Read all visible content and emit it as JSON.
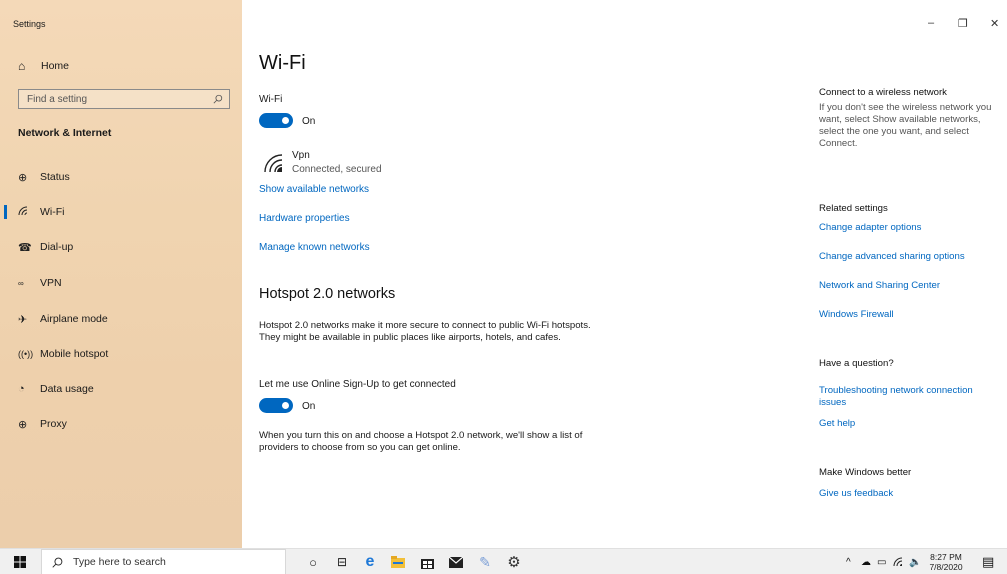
{
  "window": {
    "title": "Settings",
    "minimize": "–",
    "restore": "❐",
    "close": "✕"
  },
  "sidebar": {
    "home_label": "Home",
    "search_placeholder": "Find a setting",
    "section": "Network & Internet",
    "items": [
      {
        "label": "Status",
        "icon": "status-icon"
      },
      {
        "label": "Wi-Fi",
        "icon": "wifi-icon"
      },
      {
        "label": "Dial-up",
        "icon": "dialup-icon"
      },
      {
        "label": "VPN",
        "icon": "vpn-icon"
      },
      {
        "label": "Airplane mode",
        "icon": "airplane-icon"
      },
      {
        "label": "Mobile hotspot",
        "icon": "hotspot-icon"
      },
      {
        "label": "Data usage",
        "icon": "data-usage-icon"
      },
      {
        "label": "Proxy",
        "icon": "proxy-icon"
      }
    ]
  },
  "main": {
    "title": "Wi-Fi",
    "wifi_label": "Wi-Fi",
    "wifi_toggle": "On",
    "network_name": "Vpn",
    "network_status": "Connected, secured",
    "links": [
      "Show available networks",
      "Hardware properties",
      "Manage known networks"
    ],
    "hotspot_title": "Hotspot 2.0 networks",
    "hotspot_desc": "Hotspot 2.0 networks make it more secure to connect to public Wi-Fi hotspots. They might be available in public places like airports, hotels, and cafes.",
    "signup_label": "Let me use Online Sign-Up to get connected",
    "signup_toggle": "On",
    "signup_desc": "When you turn this on and choose a Hotspot 2.0 network, we'll show a list of providers to choose from so you can get online."
  },
  "right": {
    "connect_title": "Connect to a wireless network",
    "connect_desc": "If you don't see the wireless network you want, select Show available networks, select the one you want, and select Connect.",
    "related_title": "Related settings",
    "related_links": [
      "Change adapter options",
      "Change advanced sharing options",
      "Network and Sharing Center",
      "Windows Firewall"
    ],
    "question_title": "Have a question?",
    "question_links": [
      "Troubleshooting network connection issues",
      "Get help"
    ],
    "better_title": "Make Windows better",
    "feedback_link": "Give us feedback"
  },
  "taskbar": {
    "search_placeholder": "Type here to search",
    "time": "8:27 PM",
    "date": "7/8/2020"
  },
  "colors": {
    "accent": "#0067c0"
  }
}
